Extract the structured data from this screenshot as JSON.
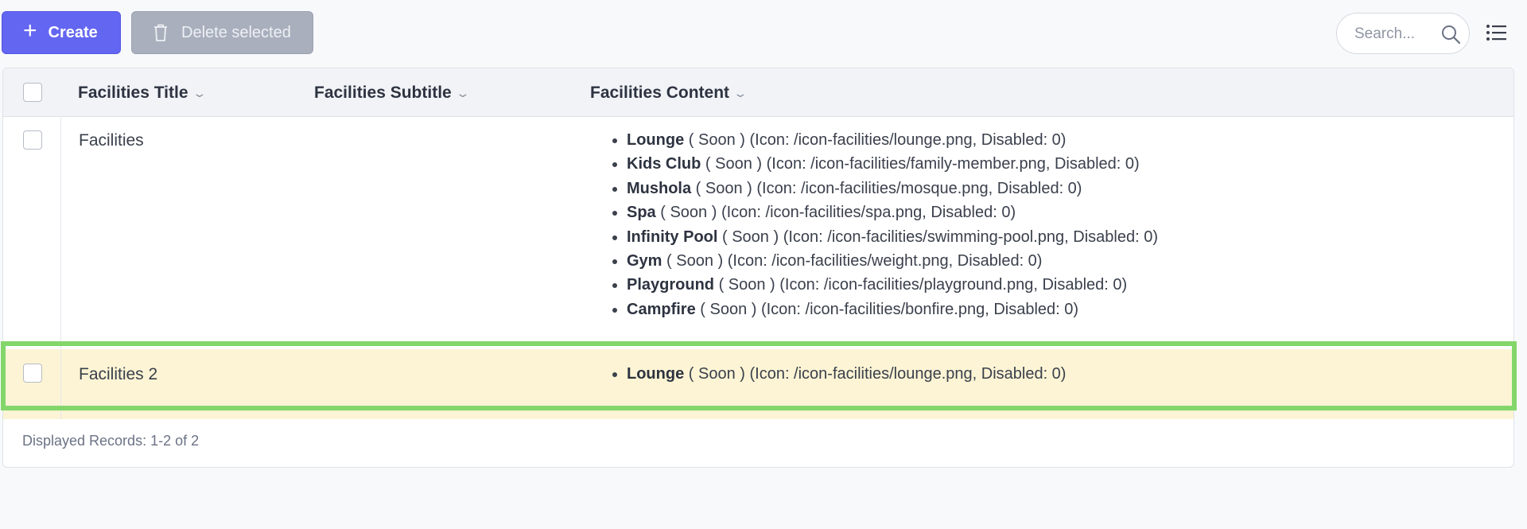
{
  "toolbar": {
    "create_label": "Create",
    "delete_label": "Delete selected",
    "search_placeholder": "Search..."
  },
  "table": {
    "columns": [
      "Facilities Title",
      "Facilities Subtitle",
      "Facilities Content"
    ],
    "rows": [
      {
        "title": "Facilities",
        "subtitle": "",
        "items": [
          {
            "name": "Lounge",
            "detail": " ( Soon ) (Icon: /icon-facilities/lounge.png, Disabled: 0)"
          },
          {
            "name": "Kids Club",
            "detail": " ( Soon ) (Icon: /icon-facilities/family-member.png, Disabled: 0)"
          },
          {
            "name": "Mushola",
            "detail": " ( Soon ) (Icon: /icon-facilities/mosque.png, Disabled: 0)"
          },
          {
            "name": "Spa",
            "detail": " ( Soon ) (Icon: /icon-facilities/spa.png, Disabled: 0)"
          },
          {
            "name": "Infinity Pool",
            "detail": " ( Soon ) (Icon: /icon-facilities/swimming-pool.png, Disabled: 0)"
          },
          {
            "name": "Gym",
            "detail": " ( Soon ) (Icon: /icon-facilities/weight.png, Disabled: 0)"
          },
          {
            "name": "Playground",
            "detail": " ( Soon ) (Icon: /icon-facilities/playground.png, Disabled: 0)"
          },
          {
            "name": "Campfire",
            "detail": " ( Soon ) (Icon: /icon-facilities/bonfire.png, Disabled: 0)"
          }
        ]
      },
      {
        "title": "Facilities 2",
        "subtitle": "",
        "items": [
          {
            "name": "Lounge",
            "detail": " ( Soon ) (Icon: /icon-facilities/lounge.png, Disabled: 0)"
          }
        ]
      }
    ],
    "footer": "Displayed Records: 1-2 of 2"
  },
  "icons": {
    "create": "plus-icon",
    "delete": "trash-icon",
    "search": "search-icon",
    "view_toggle": "list-icon",
    "sort": "chevron-down-icon"
  },
  "colors": {
    "primary": "#6366f1",
    "disabled_button": "#a9afbd",
    "row_highlight_bg": "#fcf4d4",
    "highlight_border": "#82d66a"
  }
}
